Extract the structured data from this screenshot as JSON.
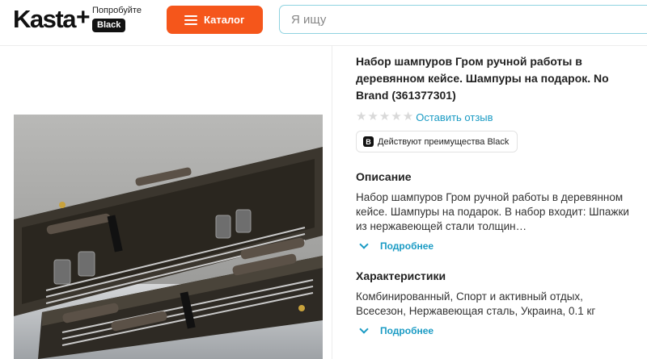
{
  "header": {
    "logo": "Kasta",
    "logo_plus": "+",
    "promo_text": "Попробуйте",
    "promo_badge": "Black",
    "catalog_label": "Каталог",
    "search_placeholder": "Я ищу"
  },
  "product": {
    "title": "Набор шампуров Гром ручной работы в деревянном кейсе. Шампуры на подарок. No Brand (361377301)",
    "rating_stars": 0,
    "review_link": "Оставить отзыв",
    "benefit_icon": "B",
    "benefit_text": "Действуют преимущества Black"
  },
  "description": {
    "title": "Описание",
    "text": "Набор шампуров Гром ручной работы в деревянном кейсе. Шампуры на подарок. В набор входит: Шпажки из нержавеющей стали толщин…",
    "more": "Подробнее"
  },
  "characteristics": {
    "title": "Характеристики",
    "text": "Комбинированный, Спорт и активный отдых, Всесезон, Нержавеющая сталь, Украина, 0.1 кг",
    "more": "Подробнее"
  },
  "colors": {
    "accent": "#f5561b",
    "link": "#1a9bc4",
    "search_border": "#8fd3e0"
  }
}
